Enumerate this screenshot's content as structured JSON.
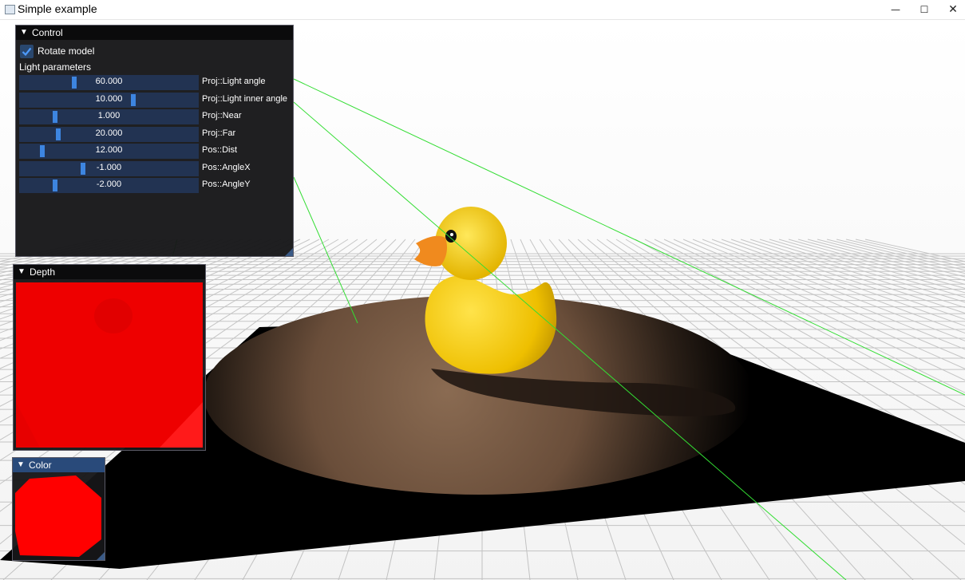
{
  "window": {
    "title": "Simple example",
    "minimize_glyph": "—",
    "maximize_glyph": "☐",
    "close_glyph": "✕"
  },
  "control": {
    "title": "Control",
    "rotate_model_label": "Rotate model",
    "rotate_model_checked": true,
    "section_label": "Light parameters",
    "sliders": [
      {
        "label": "Proj::Light angle",
        "value": "60.000",
        "fill": 0.3
      },
      {
        "label": "Proj::Light inner angle",
        "value": "10.000",
        "fill": 0.64
      },
      {
        "label": "Proj::Near",
        "value": "1.000",
        "fill": 0.19
      },
      {
        "label": "Proj::Far",
        "value": "20.000",
        "fill": 0.21
      },
      {
        "label": "Pos::Dist",
        "value": "12.000",
        "fill": 0.12
      },
      {
        "label": "Pos::AngleX",
        "value": "-1.000",
        "fill": 0.35
      },
      {
        "label": "Pos::AngleY",
        "value": "-2.000",
        "fill": 0.19
      }
    ]
  },
  "depth": {
    "title": "Depth"
  },
  "color": {
    "title": "Color"
  },
  "colors": {
    "panel_bg": "#161618",
    "slider_track": "#223352",
    "slider_grab": "#3d85e0",
    "depth_red": "#f00000",
    "duck_yellow": "#f2c200",
    "beak_orange": "#f08a1e",
    "light_line": "#33dd33"
  }
}
